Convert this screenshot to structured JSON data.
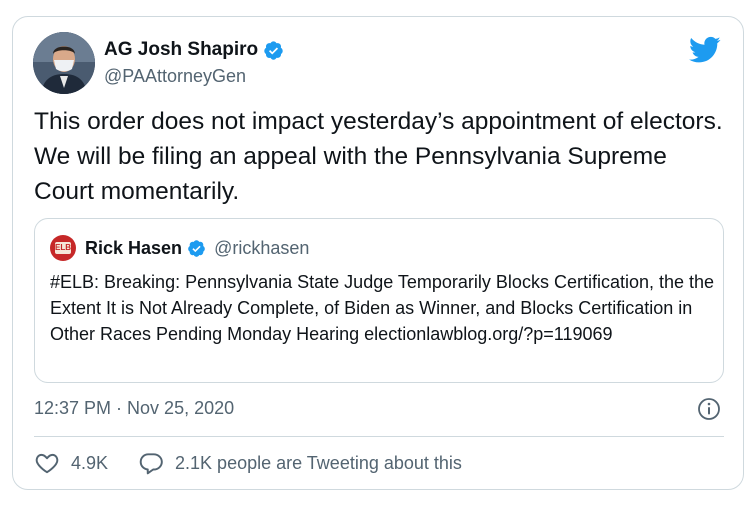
{
  "tweet": {
    "author_name": "AG Josh Shapiro",
    "author_handle": "@PAAttorneyGen",
    "text": "This order does not impact yesterday’s appointment of electors. We will be filing an appeal with the Pennsylvania Supreme Court momentarily.",
    "timestamp": "12:37 PM · Nov 25, 2020",
    "likes": "4.9K",
    "replies_label": "2.1K people are Tweeting about this"
  },
  "quoted_tweet": {
    "author_name": "Rick Hasen",
    "author_handle": "@rickhasen",
    "avatar_text": "ELB",
    "text": "#ELB: Breaking: Pennsylvania State Judge Temporarily Blocks Certification, the the Extent It is Not Already Complete, of Biden as Winner, and Blocks Certification in Other Races Pending Monday Hearing electionlawblog.org/?p=119069"
  },
  "icons": {
    "verified": "verified-badge-icon",
    "brand": "twitter-bird-icon",
    "info": "info-icon",
    "like": "heart-icon",
    "reply": "speech-bubble-icon"
  },
  "colors": {
    "brand_blue": "#1d9bf0",
    "text_primary": "#0f1419",
    "text_secondary": "#536471",
    "border": "#cfd9de"
  }
}
